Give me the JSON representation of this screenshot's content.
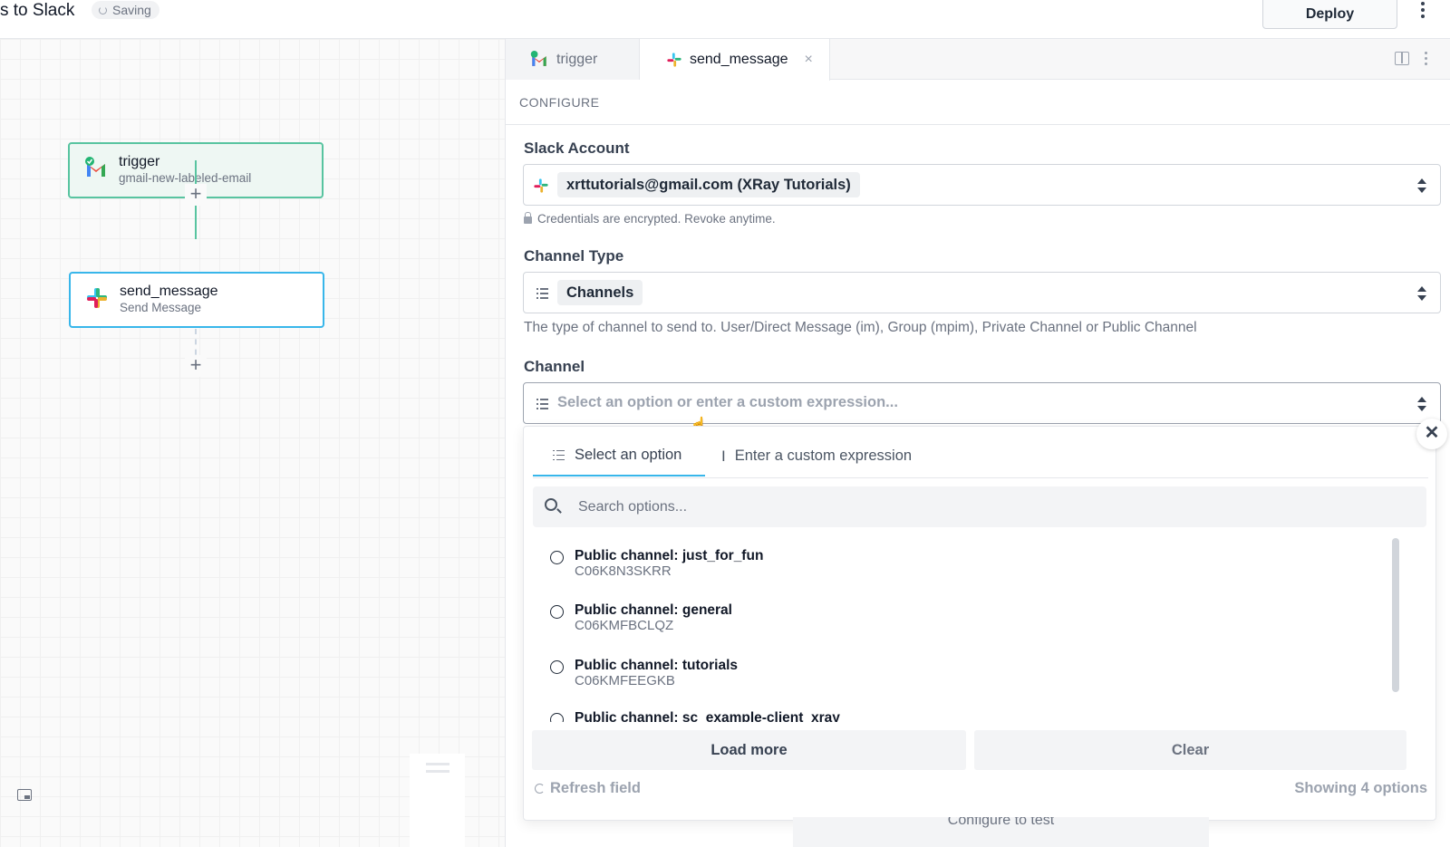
{
  "header": {
    "workflow_title": "s to Slack",
    "saving_label": "Saving",
    "deploy_label": "Deploy"
  },
  "canvas": {
    "nodes": [
      {
        "title": "trigger",
        "subtitle": "gmail-new-labeled-email",
        "icon": "gmail-icon"
      },
      {
        "title": "send_message",
        "subtitle": "Send Message",
        "icon": "slack-icon"
      }
    ],
    "add_step_glyph": "+"
  },
  "panel": {
    "tabs": [
      {
        "label": "trigger",
        "icon": "gmail-icon"
      },
      {
        "label": "send_message",
        "icon": "slack-icon",
        "close": "×"
      }
    ],
    "section_title": "CONFIGURE",
    "fields": {
      "slack_account": {
        "label": "Slack Account",
        "value": "xrttutorials@gmail.com (XRay Tutorials)",
        "help": "Credentials are encrypted. Revoke anytime."
      },
      "channel_type": {
        "label": "Channel Type",
        "value": "Channels",
        "help": "The type of channel to send to. User/Direct Message (im), Group (mpim), Private Channel or Public Channel"
      },
      "channel": {
        "label": "Channel",
        "placeholder": "Select an option or enter a custom expression..."
      }
    }
  },
  "dropdown": {
    "close_glyph": "✕",
    "tabs": [
      "Select an option",
      "Enter a custom expression"
    ],
    "search_placeholder": "Search options...",
    "options": [
      {
        "title": "Public channel: just_for_fun",
        "id": "C06K8N3SKRR"
      },
      {
        "title": "Public channel: general",
        "id": "C06KMFBCLQZ"
      },
      {
        "title": "Public channel: tutorials",
        "id": "C06KMFEEGKB"
      },
      {
        "title": "Public channel: sc_example-client_xray",
        "id": ""
      }
    ],
    "load_more_label": "Load more",
    "clear_label": "Clear",
    "refresh_label": "Refresh field",
    "showing_label": "Showing 4 options"
  },
  "footer": {
    "configure_test_label": "Configure to test"
  },
  "colors": {
    "trigger_border": "#58c4a0",
    "action_border": "#38b6ea",
    "active_tab_underline": "#38b6ea"
  }
}
